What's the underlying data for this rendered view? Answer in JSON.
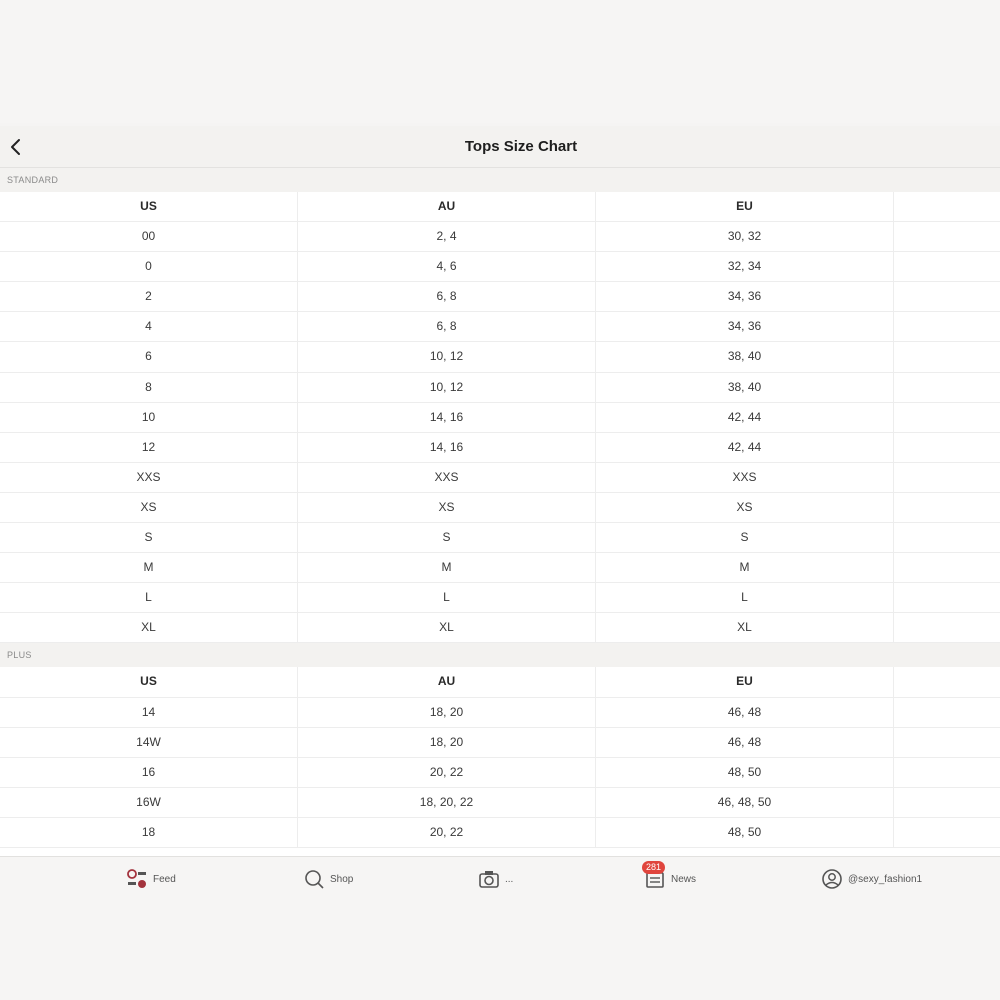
{
  "nav": {
    "title": "Tops Size Chart"
  },
  "columns": [
    "US",
    "AU",
    "EU"
  ],
  "sections": [
    {
      "label": "STANDARD",
      "rows": [
        [
          "00",
          "2, 4",
          "30, 32"
        ],
        [
          "0",
          "4, 6",
          "32, 34"
        ],
        [
          "2",
          "6, 8",
          "34, 36"
        ],
        [
          "4",
          "6, 8",
          "34, 36"
        ],
        [
          "6",
          "10, 12",
          "38, 40"
        ],
        [
          "8",
          "10, 12",
          "38, 40"
        ],
        [
          "10",
          "14, 16",
          "42, 44"
        ],
        [
          "12",
          "14, 16",
          "42, 44"
        ],
        [
          "XXS",
          "XXS",
          "XXS"
        ],
        [
          "XS",
          "XS",
          "XS"
        ],
        [
          "S",
          "S",
          "S"
        ],
        [
          "M",
          "M",
          "M"
        ],
        [
          "L",
          "L",
          "L"
        ],
        [
          "XL",
          "XL",
          "XL"
        ]
      ]
    },
    {
      "label": "PLUS",
      "rows": [
        [
          "14",
          "18, 20",
          "46, 48"
        ],
        [
          "14W",
          "18, 20",
          "46, 48"
        ],
        [
          "16",
          "20, 22",
          "48, 50"
        ],
        [
          "16W",
          "18, 20, 22",
          "46, 48, 50"
        ],
        [
          "18",
          "20, 22",
          "48, 50"
        ]
      ]
    }
  ],
  "tabbar": {
    "feed": "Feed",
    "shop": "Shop",
    "camera": "...",
    "news": "News",
    "news_badge": "281",
    "profile": "@sexy_fashion1"
  },
  "colors": {
    "badge": "#e0453d",
    "feed_icon": "#a3333d"
  }
}
